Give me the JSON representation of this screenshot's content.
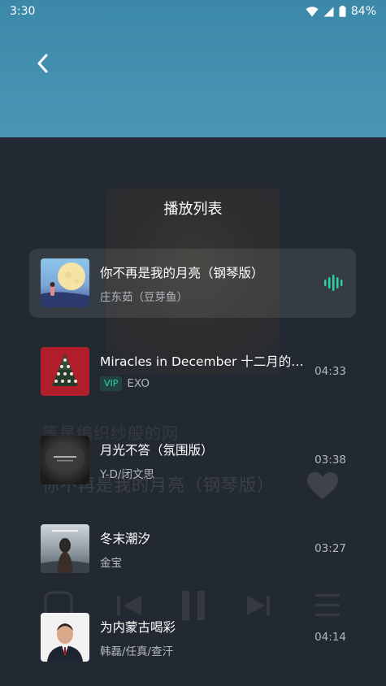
{
  "status_bar": {
    "time": "3:30",
    "battery": "84%",
    "icons": [
      "wifi-icon",
      "signal-icon",
      "battery-icon"
    ]
  },
  "header": {
    "back_icon": "chevron-left-icon"
  },
  "background_player": {
    "lyric_line": "等是编织纱般的网",
    "song_title": "你不再是我的月亮（钢琴版）"
  },
  "playlist": {
    "title": "播放列表",
    "tracks": [
      {
        "title": "你不再是我的月亮（钢琴版）",
        "artist": "庄东茹（豆芽鱼）",
        "duration": "",
        "vip": "",
        "playing": true
      },
      {
        "title": "Miracles in December 十二月的奇迹",
        "artist": "EXO",
        "duration": "04:33",
        "vip": "VIP",
        "playing": false
      },
      {
        "title": "月光不答（氛围版）",
        "artist": "Y-D/闭文思",
        "duration": "03:38",
        "vip": "",
        "playing": false
      },
      {
        "title": "冬末潮汐",
        "artist": "金宝",
        "duration": "03:27",
        "vip": "",
        "playing": false
      },
      {
        "title": "为内蒙古喝彩",
        "artist": "韩磊/任真/查汗",
        "duration": "04:14",
        "vip": "",
        "playing": false
      }
    ]
  },
  "colors": {
    "header": "#3b88a8",
    "background": "#232932",
    "accent": "#2ed1a3",
    "secondary_text": "#b3b8bf"
  }
}
